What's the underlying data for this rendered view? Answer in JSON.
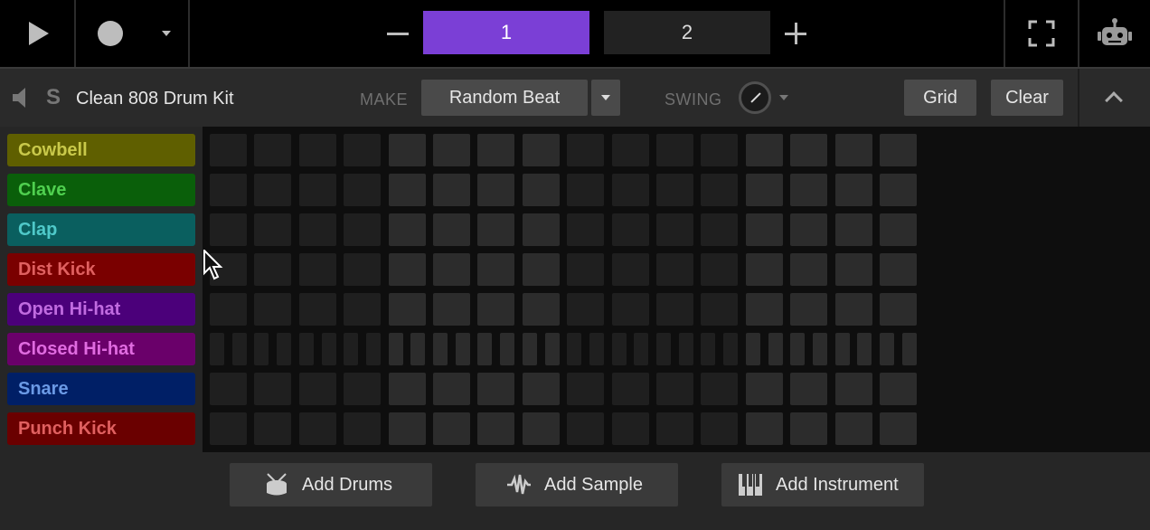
{
  "topbar": {
    "play_icon": "play-icon",
    "record_icon": "record-icon",
    "record_menu_icon": "chevron-down-icon",
    "remove_pattern_icon": "minus-icon",
    "patterns": [
      {
        "label": "1",
        "active": true
      },
      {
        "label": "2",
        "active": false
      }
    ],
    "add_pattern_icon": "plus-icon",
    "fullscreen_icon": "fullscreen-icon",
    "robot_icon": "robot-icon"
  },
  "track_header": {
    "mute_icon": "speaker-icon",
    "solo_label": "S",
    "kit_name": "Clean 808 Drum Kit",
    "make_label": "MAKE",
    "make_value": "Random Beat",
    "swing_label": "SWING",
    "grid_label": "Grid",
    "clear_label": "Clear"
  },
  "tracks": [
    {
      "label": "Cowbell",
      "color": "#5f5f00",
      "text_color": "#c9c94a",
      "steps": 16
    },
    {
      "label": "Clave",
      "color": "#0a5f0a",
      "text_color": "#4fd04f",
      "steps": 16
    },
    {
      "label": "Clap",
      "color": "#0a5f5f",
      "text_color": "#4fc9c9",
      "steps": 16
    },
    {
      "label": "Dist Kick",
      "color": "#7a0000",
      "text_color": "#e06060",
      "steps": 16
    },
    {
      "label": "Open Hi-hat",
      "color": "#4b007a",
      "text_color": "#c06be0",
      "steps": 16
    },
    {
      "label": "Closed Hi-hat",
      "color": "#6a006a",
      "text_color": "#e06be0",
      "steps": 32
    },
    {
      "label": "Snare",
      "color": "#001f66",
      "text_color": "#6b9ae6",
      "steps": 16
    },
    {
      "label": "Punch Kick",
      "color": "#6a0000",
      "text_color": "#e06060",
      "steps": 16
    }
  ],
  "bottom": {
    "add_drums": "Add Drums",
    "add_sample": "Add Sample",
    "add_instrument": "Add Instrument"
  }
}
